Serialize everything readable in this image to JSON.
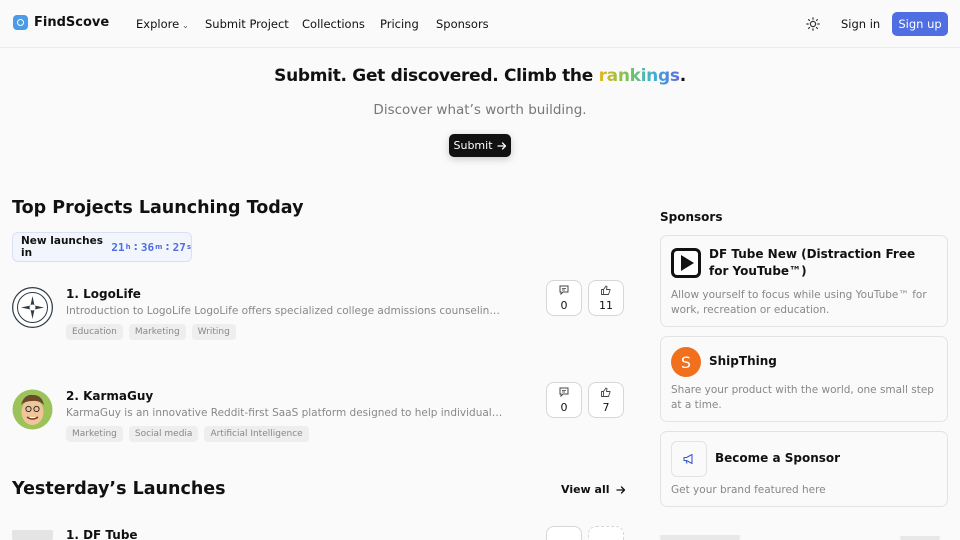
{
  "header": {
    "logo": "FindScove",
    "nav": [
      "Explore",
      "Submit Project",
      "Collections",
      "Pricing",
      "Sponsors"
    ],
    "sign_in": "Sign in",
    "sign_up": "Sign up"
  },
  "hero": {
    "title_prefix": "Submit. Get discovered. Climb the ",
    "title_highlight": "rankings",
    "title_suffix": ".",
    "subtitle": "Discover what’s worth building.",
    "submit": "Submit"
  },
  "today": {
    "title": "Top Projects Launching Today",
    "countdown_label": "New launches in",
    "hours": "21",
    "minutes": "36",
    "seconds": "27",
    "unit_h": "h",
    "unit_m": "m",
    "unit_s": "s",
    "projects": [
      {
        "name": "1. LogoLife",
        "desc": "Introduction to LogoLife LogoLife offers specialized college admissions counseling services designed to help students",
        "tags": [
          "Education",
          "Marketing",
          "Writing"
        ],
        "comments": "0",
        "upvotes": "11"
      },
      {
        "name": "2. KarmaGuy",
        "desc": "KarmaGuy is an innovative Reddit-first SaaS platform designed to help individuals and businesses grow their karma",
        "tags": [
          "Marketing",
          "Social media",
          "Artificial Intelligence"
        ],
        "comments": "0",
        "upvotes": "7"
      }
    ]
  },
  "yesterday": {
    "title": "Yesterday’s Launches",
    "view_all": "View all",
    "projects": [
      {
        "name": "1. DF Tube"
      }
    ]
  },
  "sponsors": {
    "title": "Sponsors",
    "items": [
      {
        "title": "DF Tube New (Distraction Free for YouTube™)",
        "desc": "Allow yourself to focus while using YouTube™ for work, recreation or education."
      },
      {
        "title": "ShipThing",
        "desc": "Share your product with the world, one small step at a time.",
        "icon_letter": "S"
      },
      {
        "title": "Become a Sponsor",
        "desc": "Get your brand featured here"
      }
    ]
  },
  "colors": {
    "accent": "#4f6ee2",
    "shipthing": "#f0701e"
  }
}
